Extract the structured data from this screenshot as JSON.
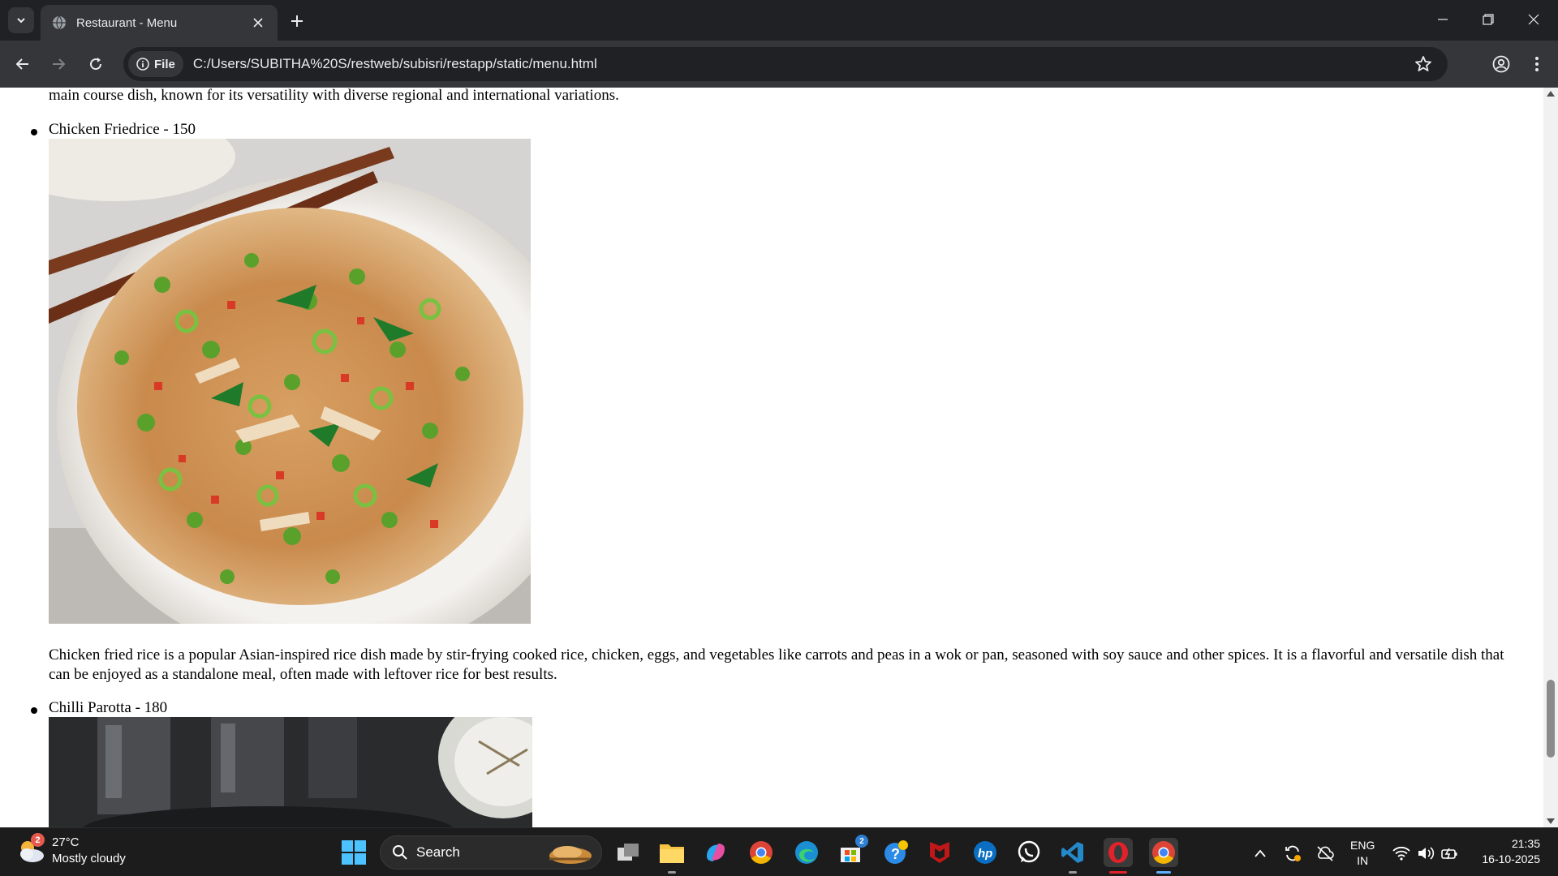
{
  "browser": {
    "tab_title": "Restaurant - Menu",
    "address_chip": "File",
    "url": "C:/Users/SUBITHA%20S/restweb/subisri/restapp/static/menu.html"
  },
  "page": {
    "prev_description": "A biryani is a flavorful, layered rice dish of Indian origin made by cooking aromatic basmati rice with marinated meat, spices, herbs, and often saffron, typically served with raita, salad, boiled eggs, and pickles. It's a popular sandwich and main course dish, known for its versatility with diverse regional and international variations.",
    "items": [
      {
        "label": "Chicken Friedrice - 150",
        "description": "Chicken fried rice is a popular Asian-inspired rice dish made by stir-frying cooked rice, chicken, eggs, and vegetables like carrots and peas in a wok or pan, seasoned with soy sauce and other spices. It is a flavorful and versatile dish that can be enjoyed as a standalone meal, often made with leftover rice for best results."
      },
      {
        "label": "Chilli Parotta - 180"
      }
    ]
  },
  "taskbar": {
    "weather_temp": "27°C",
    "weather_desc": "Mostly cloudy",
    "weather_badge": "2",
    "search_label": "Search",
    "store_badge": "2",
    "lang_line1": "ENG",
    "lang_line2": "IN",
    "time": "21:35",
    "date": "16-10-2025"
  }
}
